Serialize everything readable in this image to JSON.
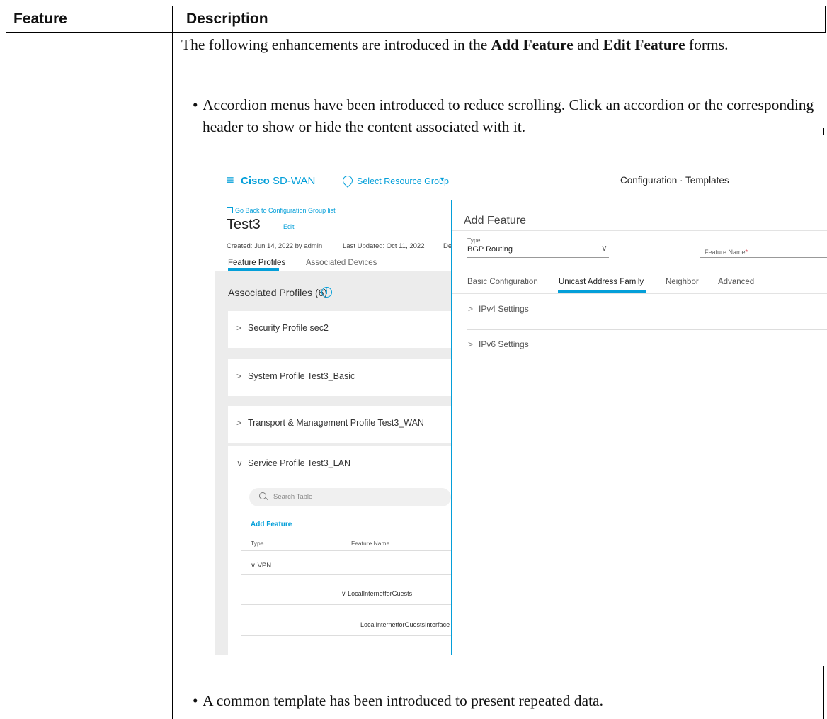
{
  "table": {
    "header_feature": "Feature",
    "header_description": "Description"
  },
  "description": {
    "intro_pre": "The following enhancements are introduced in the ",
    "intro_bold1": "Add Feature",
    "intro_mid": " and ",
    "intro_bold2": "Edit Feature",
    "intro_post": " forms.",
    "bullet1": "Accordion menus have been introduced to reduce scrolling. Click an accordion or the corresponding header to show or hide the content associated with it.",
    "bullet2": "A common template has been introduced to present repeated data.",
    "bullet_glyph": "•"
  },
  "screenshot": {
    "brand_bold": "Cisco",
    "brand_rest": " SD-WAN",
    "resource_group": "Select Resource Group",
    "resource_caret": "▾",
    "top_title": "Configuration · Templates",
    "back_link": "Go Back to Configuration Group list",
    "group_title": "Test3",
    "edit_link": "Edit",
    "created": "Created: Jun 14, 2022 by admin",
    "last_updated": "Last Updated: Oct 11, 2022",
    "meta_cut": "De",
    "tabs": [
      "Feature Profiles",
      "Associated Devices"
    ],
    "associated_profiles": "Associated Profiles (6)",
    "info_glyph": "i",
    "profiles": [
      "Security Profile sec2",
      "System Profile Test3_Basic",
      "Transport & Management Profile Test3_WAN"
    ],
    "collapsed_chevron": ">",
    "expanded_chevron": "∨",
    "service_profile": "Service Profile Test3_LAN",
    "search_placeholder": "Search Table",
    "add_feature_link": "Add Feature",
    "columns": [
      "Type",
      "Feature Name"
    ],
    "vpn_row": "∨ VPN",
    "lig_row": "∨ LocalInternetforGuests",
    "ligi_row": "LocalInternetforGuestsInterface",
    "add_feature_title": "Add Feature",
    "type_label": "Type",
    "type_value": "BGP Routing",
    "type_chevron": "∨",
    "feature_name_label": "Feature Name",
    "required_mark": "*",
    "form_tabs": [
      "Basic Configuration",
      "Unicast Address Family",
      "Neighbor",
      "Advanced"
    ],
    "settings": [
      "IPv4 Settings",
      "IPv6 Settings"
    ],
    "accent_color": "#049fd9"
  }
}
